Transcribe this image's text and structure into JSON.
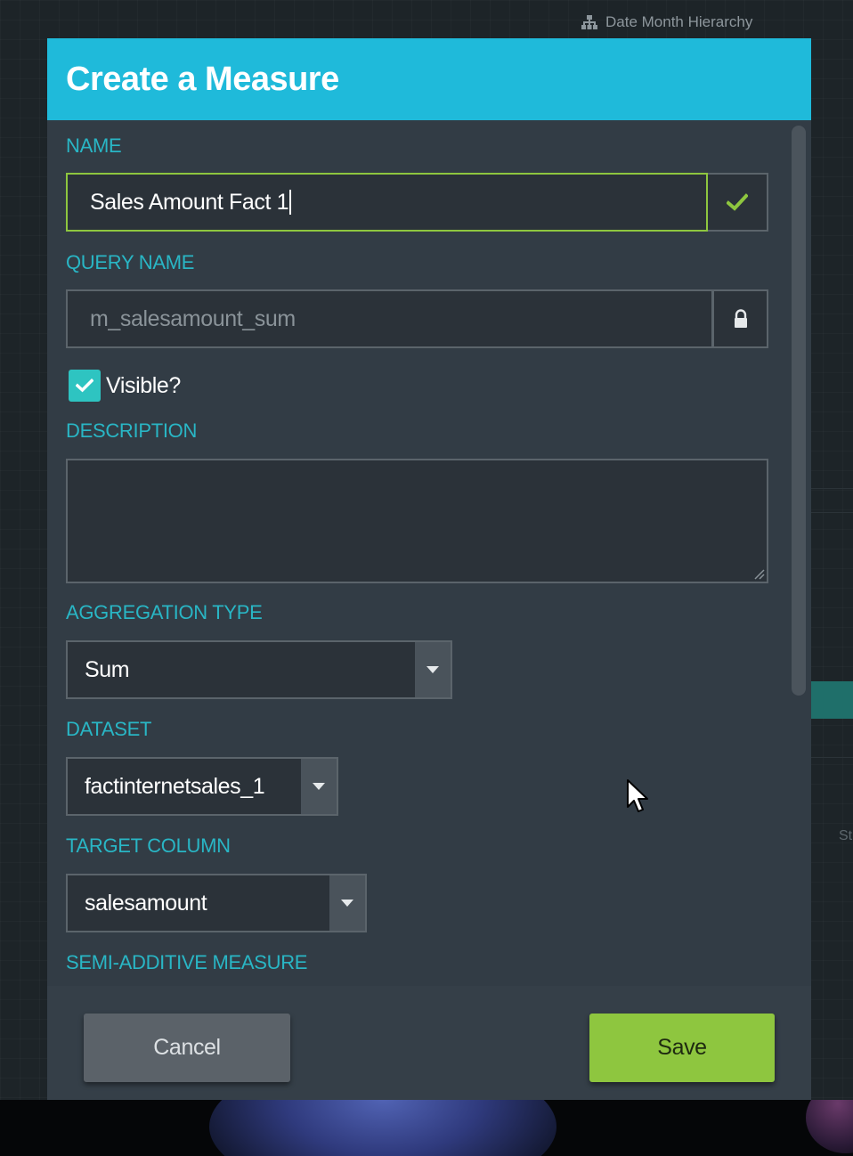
{
  "background": {
    "hierarchy_tag": "Date Month Hierarchy",
    "edge_fragment": "St"
  },
  "modal": {
    "title": "Create a Measure",
    "name": {
      "label": "NAME",
      "value": "Sales Amount Fact 1",
      "icon": "check-icon"
    },
    "query_name": {
      "label": "QUERY NAME",
      "value": "m_salesamount_sum",
      "icon": "lock-icon"
    },
    "visible": {
      "label": "Visible?",
      "checked": true
    },
    "description": {
      "label": "DESCRIPTION",
      "value": ""
    },
    "aggregation_type": {
      "label": "AGGREGATION TYPE",
      "value": "Sum"
    },
    "dataset": {
      "label": "DATASET",
      "value": "factinternetsales_1"
    },
    "target_column": {
      "label": "TARGET COLUMN",
      "value": "salesamount"
    },
    "semi_additive": {
      "label": "SEMI-ADDITIVE MEASURE"
    },
    "buttons": {
      "cancel": "Cancel",
      "save": "Save"
    }
  },
  "colors": {
    "header": "#1fbada",
    "label": "#29b6c5",
    "valid": "#8ec63f",
    "save_button": "#8ec63f",
    "cancel_button": "#5b6269",
    "checkbox": "#2ec4c1",
    "panel": "#323c45"
  }
}
